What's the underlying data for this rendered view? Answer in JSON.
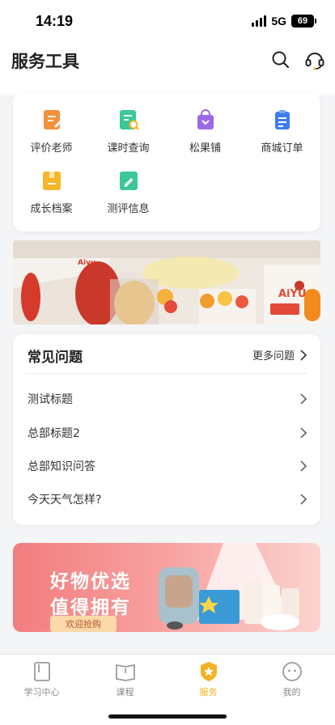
{
  "status_bar": {
    "time": "14:19",
    "network": "5G",
    "battery": "69"
  },
  "header": {
    "title": "服务工具",
    "search_icon": "search-icon",
    "support_icon": "headset-icon"
  },
  "tools": [
    {
      "label": "评价老师",
      "icon": "evaluate-icon",
      "color": "#f3913a"
    },
    {
      "label": "课时查询",
      "icon": "class-hour-search-icon",
      "color": "#3cc79b"
    },
    {
      "label": "松果铺",
      "icon": "shopping-bag-icon",
      "color": "#9b6ae6"
    },
    {
      "label": "商城订单",
      "icon": "order-clipboard-icon",
      "color": "#3d7cf2"
    },
    {
      "label": "成长档案",
      "icon": "growth-archive-icon",
      "color": "#f5b62a"
    },
    {
      "label": "测评信息",
      "icon": "assessment-icon",
      "color": "#3cc79b"
    }
  ],
  "banner": {
    "logo_text_left": "Aiyu",
    "logo_text_right": "AiYU"
  },
  "faq": {
    "title": "常见问题",
    "more_label": "更多问题",
    "items": [
      "测试标题",
      "总部标题2",
      "总部知识问答",
      "今天天气怎样?"
    ]
  },
  "promo": {
    "line1": "好物优选",
    "line2": "值得拥有",
    "button": "欢迎抢购"
  },
  "tabbar": {
    "items": [
      {
        "label": "学习中心",
        "icon": "study-center-icon"
      },
      {
        "label": "课程",
        "icon": "course-book-icon"
      },
      {
        "label": "服务",
        "icon": "service-shield-icon",
        "active": true
      },
      {
        "label": "我的",
        "icon": "profile-icon"
      }
    ]
  },
  "colors": {
    "accent": "#f2b322",
    "promo_pink": "#f27d7e"
  }
}
